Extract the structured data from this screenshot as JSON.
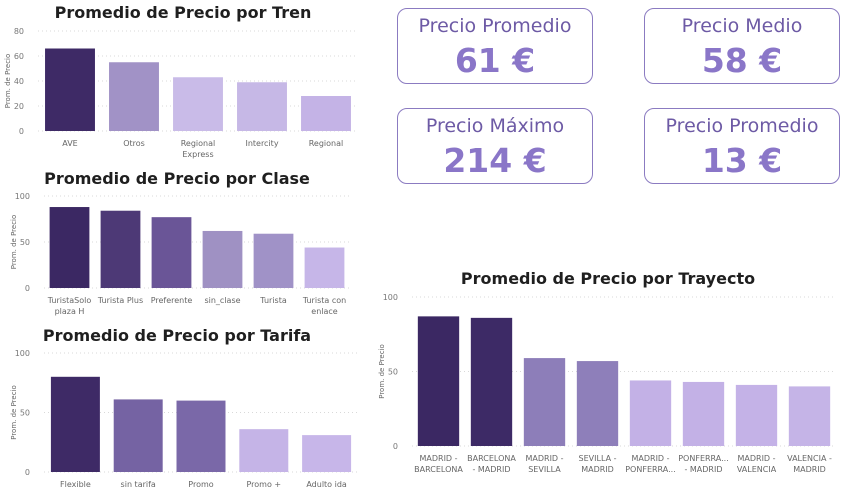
{
  "chart_data": [
    {
      "id": "tren",
      "type": "bar",
      "title": "Promedio de Precio por Tren",
      "ylabel": "Prom. de Precio",
      "ylim": [
        0,
        80
      ],
      "yticks": [
        0,
        20,
        40,
        60,
        80
      ],
      "categories": [
        "AVE",
        "Otros",
        "Regional\nExpress",
        "Intercity",
        "Regional"
      ],
      "values": [
        66,
        55,
        43,
        39,
        28
      ],
      "colors": [
        "#3e2a66",
        "#a192c6",
        "#c9bbe8",
        "#c6b8e6",
        "#c4b3e6"
      ],
      "grid": true
    },
    {
      "id": "clase",
      "type": "bar",
      "title": "Promedio de Precio por Clase",
      "ylabel": "Prom. de Precio",
      "ylim": [
        0,
        100
      ],
      "yticks": [
        0,
        50,
        100
      ],
      "categories": [
        "TuristaSolo\nplaza H",
        "Turista Plus",
        "Preferente",
        "sin_clase",
        "Turista",
        "Turista con\nenlace"
      ],
      "values": [
        88,
        84,
        77,
        62,
        59,
        44
      ],
      "colors": [
        "#3b2863",
        "#4d3976",
        "#6a5597",
        "#9f91c3",
        "#a092c7",
        "#c6b6e8"
      ],
      "grid": true
    },
    {
      "id": "tarifa",
      "type": "bar",
      "title": "Promedio de Precio por Tarifa",
      "ylabel": "Prom. de Precio",
      "ylim": [
        0,
        100
      ],
      "yticks": [
        0,
        50,
        100
      ],
      "categories": [
        "Flexible",
        "sin tarifa",
        "Promo",
        "Promo +",
        "Adulto ida"
      ],
      "values": [
        80,
        61,
        60,
        36,
        31
      ],
      "colors": [
        "#3e2a66",
        "#7563a3",
        "#7a68a8",
        "#c5b4e7",
        "#c7b6e9"
      ],
      "grid": true
    },
    {
      "id": "trayecto",
      "type": "bar",
      "title": "Promedio de Precio por Trayecto",
      "ylabel": "Prom. de Precio",
      "ylim": [
        0,
        100
      ],
      "yticks": [
        0,
        50,
        100
      ],
      "categories": [
        "MADRID -\nBARCELONA",
        "BARCELONA\n- MADRID",
        "MADRID -\nSEVILLA",
        "SEVILLA -\nMADRID",
        "MADRID -\nPONFERRA...",
        "PONFERRA...\n- MADRID",
        "MADRID -\nVALENCIA",
        "VALENCIA -\nMADRID"
      ],
      "values": [
        87,
        86,
        59,
        57,
        44,
        43,
        41,
        40
      ],
      "colors": [
        "#3b2863",
        "#3d2a66",
        "#8d7eb9",
        "#8e7fba",
        "#c3b1e6",
        "#c3b1e6",
        "#c4b2e7",
        "#c5b4e7"
      ],
      "grid": true
    }
  ],
  "kpi_cards": [
    {
      "label": "Precio Promedio",
      "value": "61 €"
    },
    {
      "label": "Precio Medio",
      "value": "58 €"
    },
    {
      "label": "Precio Máximo",
      "value": "214 €"
    },
    {
      "label": "Precio Promedio",
      "value": "13 €"
    }
  ]
}
